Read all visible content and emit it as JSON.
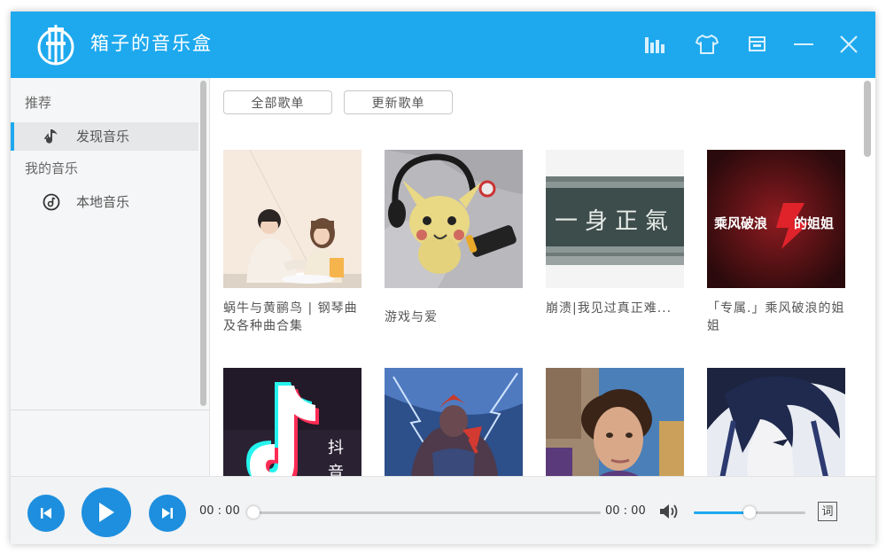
{
  "app": {
    "title": "箱子的音乐盒"
  },
  "titlebar": {
    "buttons": [
      "equalizer-icon",
      "skin-icon",
      "minimize-restore-icon",
      "minimize-icon",
      "close-icon"
    ]
  },
  "sidebar": {
    "section_recommend": "推荐",
    "discover_label": "发现音乐",
    "section_my_music": "我的音乐",
    "local_label": "本地音乐"
  },
  "main": {
    "filter_all": "全部歌单",
    "filter_update": "更新歌单",
    "playlists": [
      {
        "title": "蜗牛与黄鹂鸟 | 钢琴曲及各种曲合集"
      },
      {
        "title": "游戏与爱"
      },
      {
        "title": "崩溃|我见过真正难..."
      },
      {
        "title": "「专属.」乘风破浪的姐姐"
      },
      {
        "title": ""
      },
      {
        "title": ""
      },
      {
        "title": ""
      },
      {
        "title": ""
      }
    ],
    "cover_texts": {
      "calligraphy": "一身正氣",
      "show_logo": "乘风破浪",
      "show_logo_b": "的姐姐",
      "douyin": "抖音"
    }
  },
  "player": {
    "current_time": "00 : 00",
    "total_time": "00 : 00",
    "progress": 0,
    "volume": 0.5,
    "lyric_label": "词"
  },
  "colors": {
    "accent": "#1ea9ee",
    "control": "#1e8fde"
  }
}
